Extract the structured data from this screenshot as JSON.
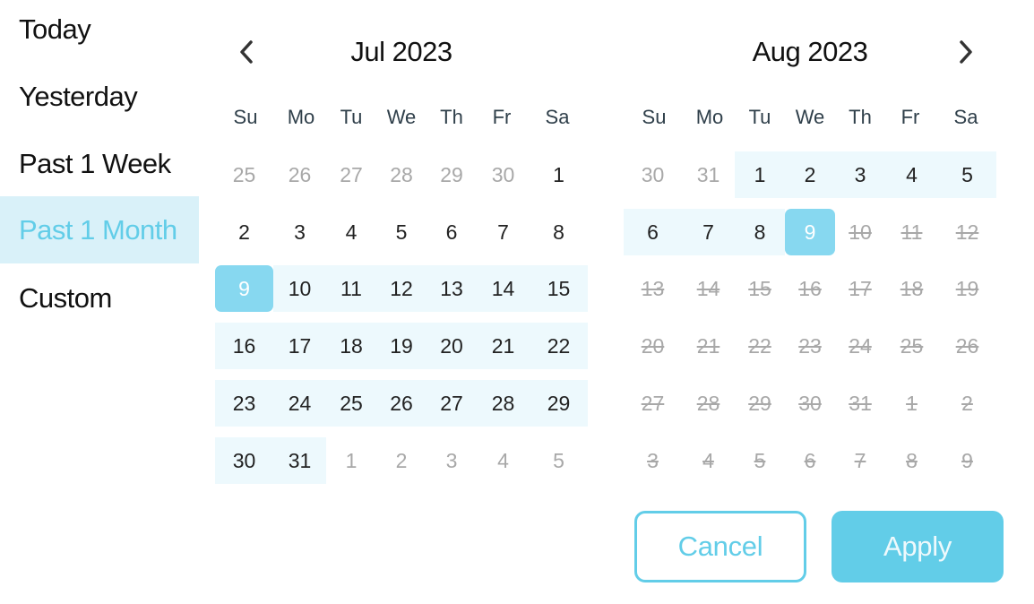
{
  "presets": [
    {
      "label": "Today",
      "active": false
    },
    {
      "label": "Yesterday",
      "active": false
    },
    {
      "label": "Past 1 Week",
      "active": false
    },
    {
      "label": "Past 1 Month",
      "active": true
    },
    {
      "label": "Custom",
      "active": false
    }
  ],
  "weekdays": [
    "Su",
    "Mo",
    "Tu",
    "We",
    "Th",
    "Fr",
    "Sa"
  ],
  "colors": {
    "accent": "#62cde8",
    "selected_day": "#87d8f0",
    "range_bg": "#edf9fd",
    "preset_active_bg": "#d9f1f9",
    "muted_text": "#a8a8a8"
  },
  "calendars": [
    {
      "title": "Jul 2023",
      "nav": "prev",
      "nav_icon": "chevron-left-icon",
      "weeks": [
        [
          {
            "d": "25",
            "s": "other"
          },
          {
            "d": "26",
            "s": "other"
          },
          {
            "d": "27",
            "s": "other"
          },
          {
            "d": "28",
            "s": "other"
          },
          {
            "d": "29",
            "s": "other"
          },
          {
            "d": "30",
            "s": "other"
          },
          {
            "d": "1",
            "s": "normal"
          }
        ],
        [
          {
            "d": "2",
            "s": "normal"
          },
          {
            "d": "3",
            "s": "normal"
          },
          {
            "d": "4",
            "s": "normal"
          },
          {
            "d": "5",
            "s": "normal"
          },
          {
            "d": "6",
            "s": "normal"
          },
          {
            "d": "7",
            "s": "normal"
          },
          {
            "d": "8",
            "s": "normal"
          }
        ],
        [
          {
            "d": "9",
            "s": "selected"
          },
          {
            "d": "10",
            "s": "inrange"
          },
          {
            "d": "11",
            "s": "inrange"
          },
          {
            "d": "12",
            "s": "inrange"
          },
          {
            "d": "13",
            "s": "inrange"
          },
          {
            "d": "14",
            "s": "inrange"
          },
          {
            "d": "15",
            "s": "inrange"
          }
        ],
        [
          {
            "d": "16",
            "s": "inrange"
          },
          {
            "d": "17",
            "s": "inrange"
          },
          {
            "d": "18",
            "s": "inrange"
          },
          {
            "d": "19",
            "s": "inrange"
          },
          {
            "d": "20",
            "s": "inrange"
          },
          {
            "d": "21",
            "s": "inrange"
          },
          {
            "d": "22",
            "s": "inrange"
          }
        ],
        [
          {
            "d": "23",
            "s": "inrange"
          },
          {
            "d": "24",
            "s": "inrange"
          },
          {
            "d": "25",
            "s": "inrange"
          },
          {
            "d": "26",
            "s": "inrange"
          },
          {
            "d": "27",
            "s": "inrange"
          },
          {
            "d": "28",
            "s": "inrange"
          },
          {
            "d": "29",
            "s": "inrange"
          }
        ],
        [
          {
            "d": "30",
            "s": "inrange"
          },
          {
            "d": "31",
            "s": "inrange"
          },
          {
            "d": "1",
            "s": "other"
          },
          {
            "d": "2",
            "s": "other"
          },
          {
            "d": "3",
            "s": "other"
          },
          {
            "d": "4",
            "s": "other"
          },
          {
            "d": "5",
            "s": "other"
          }
        ]
      ]
    },
    {
      "title": "Aug 2023",
      "nav": "next",
      "nav_icon": "chevron-right-icon",
      "weeks": [
        [
          {
            "d": "30",
            "s": "other"
          },
          {
            "d": "31",
            "s": "other"
          },
          {
            "d": "1",
            "s": "inrange"
          },
          {
            "d": "2",
            "s": "inrange"
          },
          {
            "d": "3",
            "s": "inrange"
          },
          {
            "d": "4",
            "s": "inrange"
          },
          {
            "d": "5",
            "s": "inrange"
          }
        ],
        [
          {
            "d": "6",
            "s": "inrange"
          },
          {
            "d": "7",
            "s": "inrange"
          },
          {
            "d": "8",
            "s": "inrange"
          },
          {
            "d": "9",
            "s": "selected"
          },
          {
            "d": "10",
            "s": "disabled"
          },
          {
            "d": "11",
            "s": "disabled"
          },
          {
            "d": "12",
            "s": "disabled"
          }
        ],
        [
          {
            "d": "13",
            "s": "disabled"
          },
          {
            "d": "14",
            "s": "disabled"
          },
          {
            "d": "15",
            "s": "disabled"
          },
          {
            "d": "16",
            "s": "disabled"
          },
          {
            "d": "17",
            "s": "disabled"
          },
          {
            "d": "18",
            "s": "disabled"
          },
          {
            "d": "19",
            "s": "disabled"
          }
        ],
        [
          {
            "d": "20",
            "s": "disabled"
          },
          {
            "d": "21",
            "s": "disabled"
          },
          {
            "d": "22",
            "s": "disabled"
          },
          {
            "d": "23",
            "s": "disabled"
          },
          {
            "d": "24",
            "s": "disabled"
          },
          {
            "d": "25",
            "s": "disabled"
          },
          {
            "d": "26",
            "s": "disabled"
          }
        ],
        [
          {
            "d": "27",
            "s": "disabled"
          },
          {
            "d": "28",
            "s": "disabled"
          },
          {
            "d": "29",
            "s": "disabled"
          },
          {
            "d": "30",
            "s": "disabled"
          },
          {
            "d": "31",
            "s": "disabled"
          },
          {
            "d": "1",
            "s": "disabled"
          },
          {
            "d": "2",
            "s": "disabled"
          }
        ],
        [
          {
            "d": "3",
            "s": "disabled"
          },
          {
            "d": "4",
            "s": "disabled"
          },
          {
            "d": "5",
            "s": "disabled"
          },
          {
            "d": "6",
            "s": "disabled"
          },
          {
            "d": "7",
            "s": "disabled"
          },
          {
            "d": "8",
            "s": "disabled"
          },
          {
            "d": "9",
            "s": "disabled"
          }
        ]
      ]
    }
  ],
  "actions": {
    "cancel_label": "Cancel",
    "apply_label": "Apply"
  }
}
